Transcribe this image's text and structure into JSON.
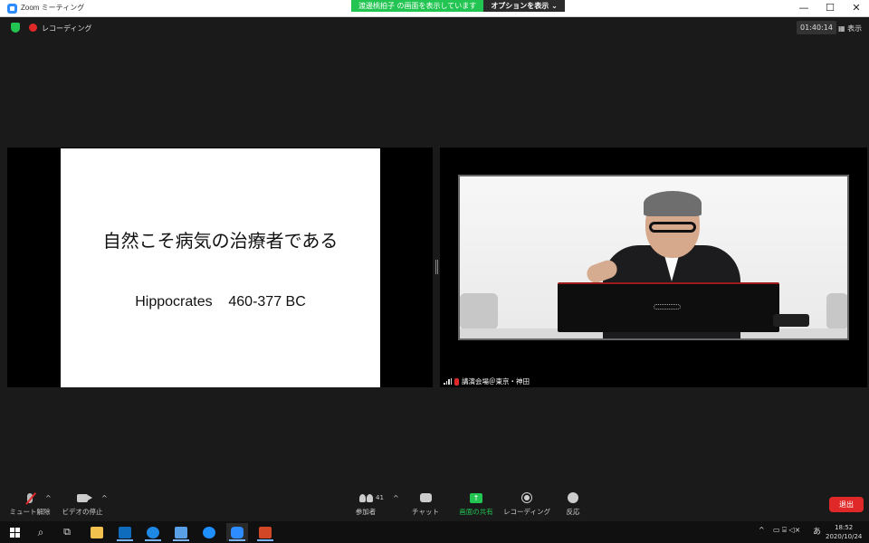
{
  "window": {
    "title": "Zoom ミーティング",
    "share_status": "渡邊桃拍子 の画面を表示しています",
    "share_options": "オプションを表示 ⌄",
    "controls": [
      "—",
      "☐",
      "✕"
    ]
  },
  "meeting_bar": {
    "recording_label": "レコーディング",
    "timer": "01:40:14",
    "view_label": "▦ 表示"
  },
  "slide": {
    "title": "自然こそ病気の治療者である",
    "subtitle": "Hippocrates    460-377 BC"
  },
  "speaker_video": {
    "name": "講演会場＠東京・神田"
  },
  "toolbar": {
    "mute_label": "ミュート解除",
    "video_label": "ビデオの停止",
    "participants_label": "参加者",
    "participants_count": "41",
    "chat_label": "チャット",
    "share_label": "画面の共有",
    "share_glyph": "↑",
    "record_label": "レコーディング",
    "reactions_label": "反応",
    "leave_label": "退出",
    "caret": "^"
  },
  "taskbar": {
    "search_glyph": "⌕",
    "taskview_glyph": "⧉",
    "tray_chevron": "^",
    "tray_icons": "▭ ⌸ ◁×",
    "ime": "あ",
    "time": "18:52",
    "date": "2020/10/24",
    "colors": {
      "explorer": "#f2c14e",
      "outlook": "#0f6cbd",
      "chrome": "#1e88e5",
      "store": "#5aa0e6",
      "edge": "#1f8fff",
      "zoom": "#2d8cff",
      "powerpoint": "#d24726"
    }
  }
}
